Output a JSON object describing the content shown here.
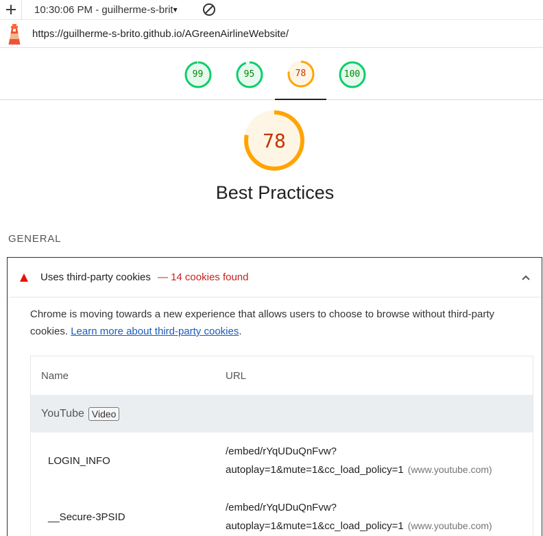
{
  "toolbar": {
    "run_label": "10:30:06 PM - guilherme-s-brit",
    "caret": "▾"
  },
  "url": "https://guilherme-s-brito.github.io/AGreenAirlineWebsite/",
  "gauges": [
    {
      "score": "99",
      "value": 0.99,
      "color": "#0cce6b",
      "text_color": "#008800",
      "fill": "#e6f9ee"
    },
    {
      "score": "95",
      "value": 0.95,
      "color": "#0cce6b",
      "text_color": "#008800",
      "fill": "#e6f9ee"
    },
    {
      "score": "78",
      "value": 0.78,
      "color": "#ffa400",
      "text_color": "#c33300",
      "fill": "#fff5e5",
      "active": true
    },
    {
      "score": "100",
      "value": 1.0,
      "color": "#0cce6b",
      "text_color": "#008800",
      "fill": "#e6f9ee"
    }
  ],
  "category": {
    "score": "78",
    "value": 0.78,
    "title": "Best Practices"
  },
  "group_title": "GENERAL",
  "audit": {
    "title": "Uses third-party cookies",
    "display_value": "— 14 cookies found",
    "description": "Chrome is moving towards a new experience that allows users to choose to browse without third-party cookies.",
    "link_text": "Learn more about third-party cookies",
    "description_end": "."
  },
  "table": {
    "headers": {
      "name": "Name",
      "url": "URL"
    },
    "group": {
      "entity": "YouTube",
      "badge": "Video"
    },
    "rows": [
      {
        "name": "LOGIN_INFO",
        "url_line1": "/embed/rYqUDuQnFvw?",
        "url_line2": "autoplay=1&mute=1&cc_load_policy=1",
        "origin": "(www.youtube.com)"
      },
      {
        "name": "__Secure-3PSID",
        "url_line1": "/embed/rYqUDuQnFvw?",
        "url_line2": "autoplay=1&mute=1&cc_load_policy=1",
        "origin": "(www.youtube.com)"
      }
    ]
  },
  "colors": {
    "pass": "#0cce6b",
    "average": "#ffa400",
    "fail": "#ff4e42",
    "link": "#1a5cbd"
  }
}
